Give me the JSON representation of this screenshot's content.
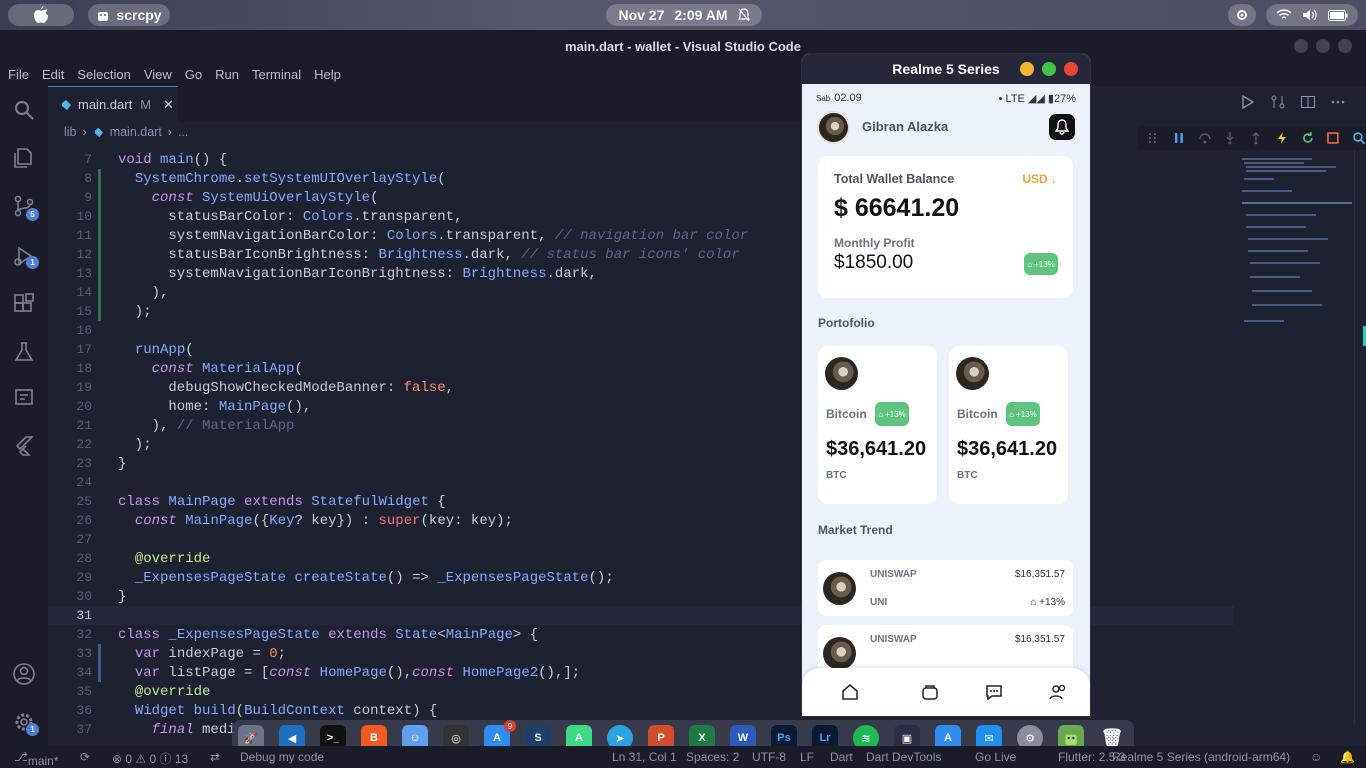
{
  "system": {
    "apple_glyph": "",
    "app_name": "scrcpy",
    "date": "Nov 27",
    "time": "2:09 AM"
  },
  "window": {
    "title": "main.dart - wallet - Visual Studio Code"
  },
  "menu": [
    "File",
    "Edit",
    "Selection",
    "View",
    "Go",
    "Run",
    "Terminal",
    "Help"
  ],
  "activity_badges": {
    "source_control": "5",
    "debug": "1",
    "settings": "1"
  },
  "tab": {
    "label": "main.dart",
    "modified": "M",
    "close": "✕"
  },
  "breadcrumb": {
    "folder": "lib",
    "file": "main.dart",
    "more": "..."
  },
  "editor": {
    "line_numbers": [
      "7",
      "8",
      "9",
      "10",
      "11",
      "12",
      "13",
      "14",
      "15",
      "16",
      "17",
      "18",
      "19",
      "20",
      "21",
      "22",
      "23",
      "24",
      "25",
      "26",
      "27",
      "28",
      "29",
      "30",
      "31",
      "32",
      "33",
      "34",
      "35",
      "36",
      "37"
    ]
  },
  "statusbar": {
    "branch": "main*",
    "problems": "⊗ 0 ⚠ 0 ⓘ 13",
    "debug": "Debug my code",
    "position": "Ln 31, Col 1",
    "spaces": "Spaces: 2",
    "encoding": "UTF-8",
    "eol": "LF",
    "language": "Dart",
    "devtools": "Dart DevTools",
    "golive": "Go Live",
    "flutter": "Flutter: 2.5.3",
    "device": "Realme 5 Series (android-arm64)"
  },
  "dock_badge": "9",
  "phone": {
    "window_title": "Realme 5 Series",
    "status_left_day": "Sab",
    "status_left_time": "02.09",
    "status_right": "LTE",
    "battery": "27%",
    "user_name": "Gibran Alazka",
    "balance": {
      "label": "Total Wallet Balance",
      "currency": "USD",
      "amount": "$ 66641.20",
      "profit_label": "Monthly Profit",
      "profit": "$1850.00",
      "profit_change": "+13%"
    },
    "portfolio_title": "Portofolio",
    "portfolio": [
      {
        "name": "Bitcoin",
        "change": "+13%",
        "price": "$36,641.20",
        "symbol": "BTC"
      },
      {
        "name": "Bitcoin",
        "change": "+13%",
        "price": "$36,641.20",
        "symbol": "BTC"
      }
    ],
    "market_title": "Market Trend",
    "market": [
      {
        "name": "UNISWAP",
        "symbol": "UNI",
        "price": "$16,351.57",
        "change": "+13%"
      },
      {
        "name": "UNISWAP",
        "symbol": "",
        "price": "$16,351.57",
        "change": ""
      }
    ]
  }
}
